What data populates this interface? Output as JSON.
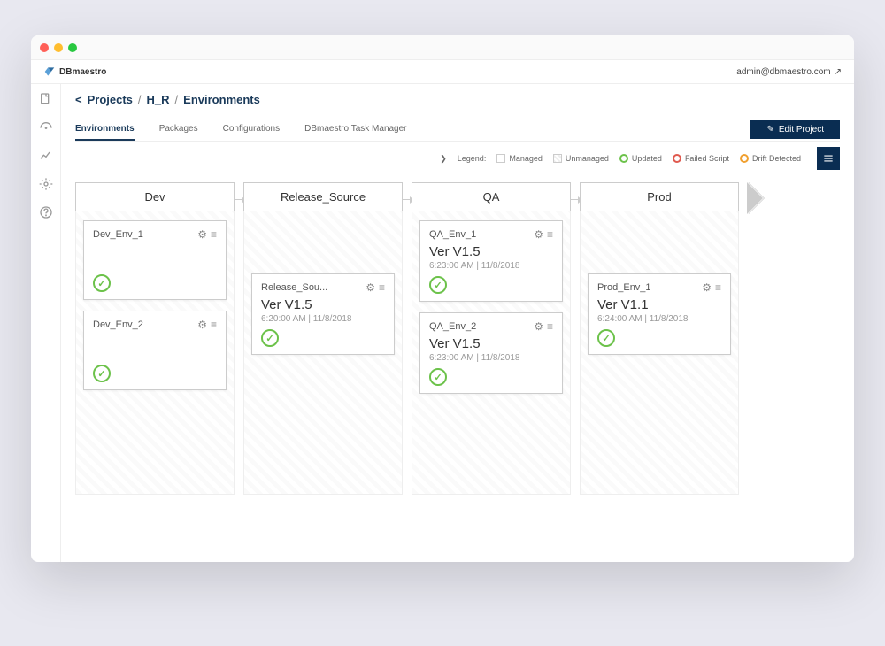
{
  "brand": "DBmaestro",
  "user_email": "admin@dbmaestro.com",
  "breadcrumb": {
    "back": "<",
    "a": "Projects",
    "b": "H_R",
    "c": "Environments"
  },
  "tabs": {
    "environments": "Environments",
    "packages": "Packages",
    "configurations": "Configurations",
    "task_manager": "DBmaestro Task Manager"
  },
  "edit_button": "Edit Project",
  "legend": {
    "label": "Legend:",
    "managed": "Managed",
    "unmanaged": "Unmanaged",
    "updated": "Updated",
    "failed": "Failed Script",
    "drift": "Drift Detected"
  },
  "stages": [
    {
      "name": "Dev",
      "cards": [
        {
          "title": "Dev_Env_1",
          "version": "",
          "ts": "",
          "simple": true
        },
        {
          "title": "Dev_Env_2",
          "version": "",
          "ts": "",
          "simple": true
        }
      ]
    },
    {
      "name": "Release_Source",
      "cards": [
        {
          "title": "Release_Sou...",
          "version": "Ver V1.5",
          "ts": "6:20:00 AM   |   11/8/2018",
          "simple": false,
          "offset": true
        }
      ]
    },
    {
      "name": "QA",
      "cards": [
        {
          "title": "QA_Env_1",
          "version": "Ver V1.5",
          "ts": "6:23:00 AM   |   11/8/2018",
          "simple": false
        },
        {
          "title": "QA_Env_2",
          "version": "Ver V1.5",
          "ts": "6:23:00 AM   |   11/8/2018",
          "simple": false
        }
      ]
    },
    {
      "name": "Prod",
      "cards": [
        {
          "title": "Prod_Env_1",
          "version": "Ver V1.1",
          "ts": "6:24:00 AM   |   11/8/2018",
          "simple": false,
          "offset": true
        }
      ]
    }
  ]
}
